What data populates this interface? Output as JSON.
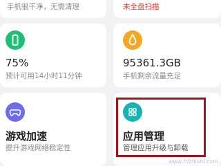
{
  "cards": {
    "cleanup": {
      "subtitle": "手机很干净，无需清理"
    },
    "virus": {
      "subtitle": "未全盘扫描"
    },
    "battery": {
      "icon": "battery-icon",
      "value": "75%",
      "subtitle": "预计可用14小时11分钟"
    },
    "data": {
      "icon": "water-drop-icon",
      "value": "95361.3GB",
      "subtitle": "手机剩余流量充足"
    },
    "game": {
      "icon": "gamepad-icon",
      "title": "游戏加速",
      "subtitle": "提升游戏网络稳定性"
    },
    "apps": {
      "icon": "app-grid-icon",
      "title": "应用管理",
      "subtitle": "管理应用升级与卸载"
    }
  },
  "colors": {
    "battery": "#1fbf78",
    "data": "#f5a623",
    "game": "#6c6cf0",
    "apps": "#17b3b3",
    "warning": "#e5322d",
    "highlight": "#a0141c"
  },
  "watermark": "www.hfzhishi.com"
}
